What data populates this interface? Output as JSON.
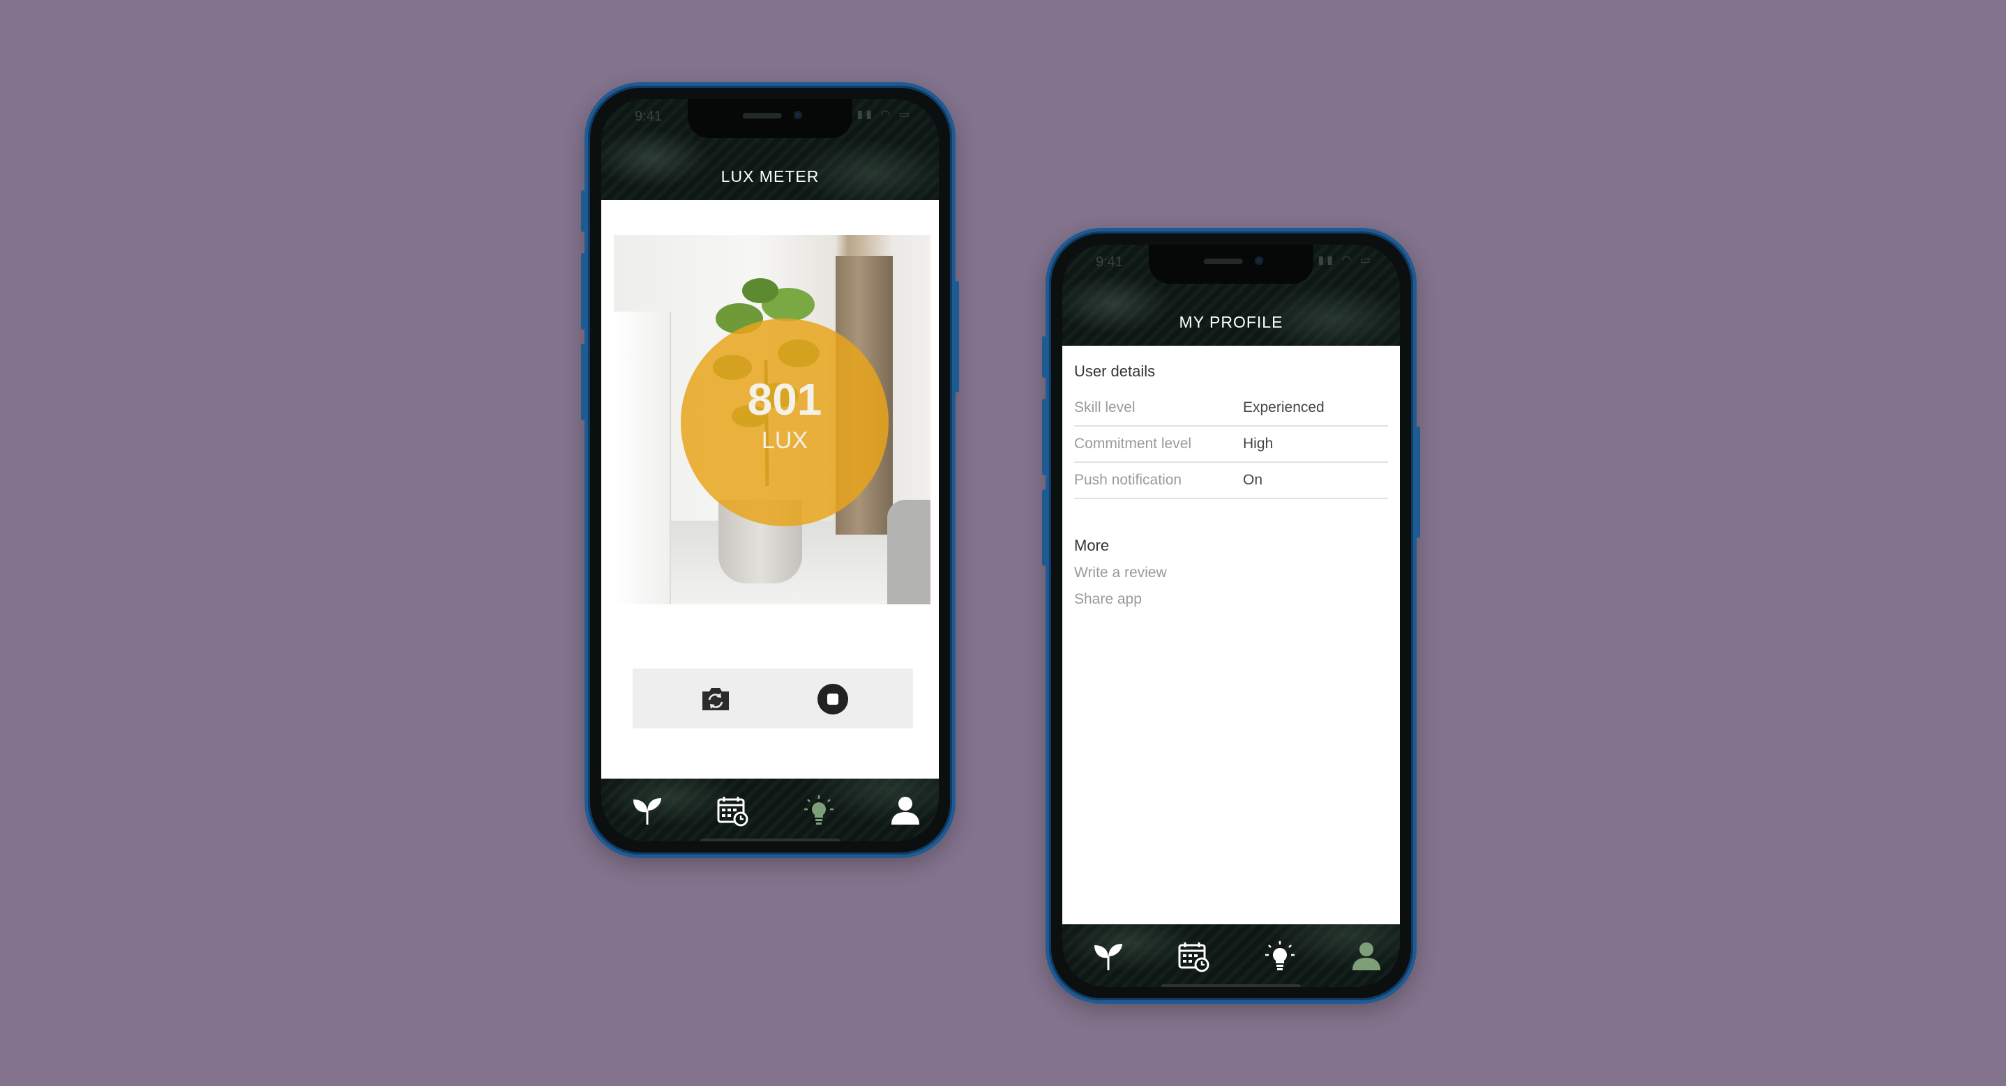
{
  "phone1": {
    "status": {
      "time": "9:41",
      "icons": "▮▮ ◠ ▭"
    },
    "header_title": "LUX METER",
    "lux": {
      "value": "801",
      "unit": "LUX"
    },
    "controls": {
      "switch_camera_icon": "camera-switch-icon",
      "stop_icon": "stop-icon"
    }
  },
  "phone2": {
    "status": {
      "time": "9:41",
      "icons": "▮▮ ◠ ▭"
    },
    "header_title": "MY PROFILE",
    "user_details": {
      "title": "User details",
      "rows": [
        {
          "label": "Skill level",
          "value": "Experienced"
        },
        {
          "label": "Commitment level",
          "value": "High"
        },
        {
          "label": "Push notification",
          "value": "On"
        }
      ]
    },
    "more": {
      "title": "More",
      "links": [
        "Write a review",
        "Share app"
      ]
    }
  },
  "tabbar": {
    "icons": [
      "plant-icon",
      "calendar-icon",
      "lightbulb-icon",
      "user-icon"
    ],
    "active_color": "#7f9f78",
    "inactive_color": "#ffffff"
  },
  "colors": {
    "background": "#83738d",
    "phone_frame": "#1f5b93",
    "lux_circle": "#e8a51c"
  }
}
